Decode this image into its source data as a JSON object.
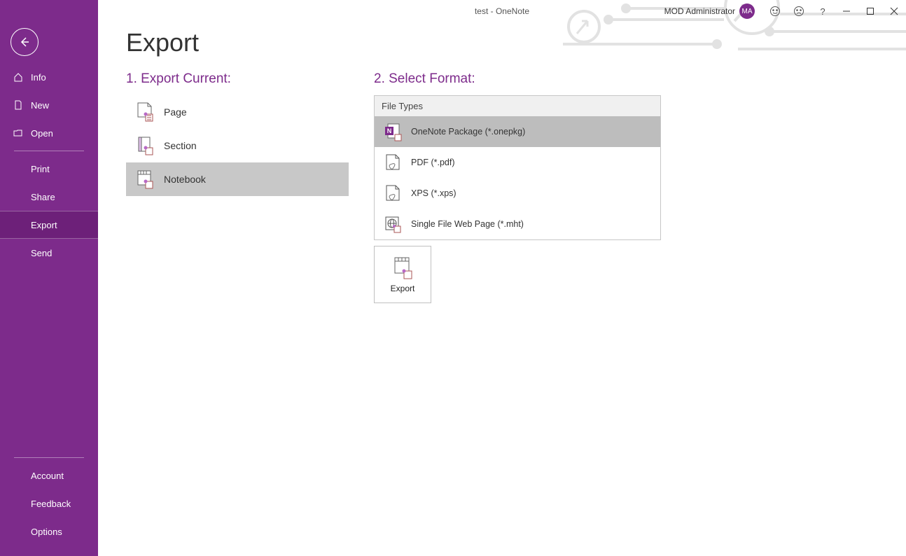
{
  "window_title": "test  -  OneNote",
  "user_name": "MOD Administrator",
  "avatar_initials": "MA",
  "sidebar": {
    "info": "Info",
    "new": "New",
    "open": "Open",
    "print": "Print",
    "share": "Share",
    "export": "Export",
    "send": "Send",
    "account": "Account",
    "feedback": "Feedback",
    "options": "Options"
  },
  "page": {
    "title": "Export",
    "section1": "1. Export Current:",
    "section2": "2. Select Format:",
    "file_types_header": "File Types",
    "items": {
      "page": "Page",
      "section": "Section",
      "notebook": "Notebook"
    },
    "formats": {
      "onepkg": "OneNote Package (*.onepkg)",
      "pdf": "PDF (*.pdf)",
      "xps": "XPS (*.xps)",
      "mht": "Single File Web Page (*.mht)"
    },
    "export_button": "Export"
  }
}
